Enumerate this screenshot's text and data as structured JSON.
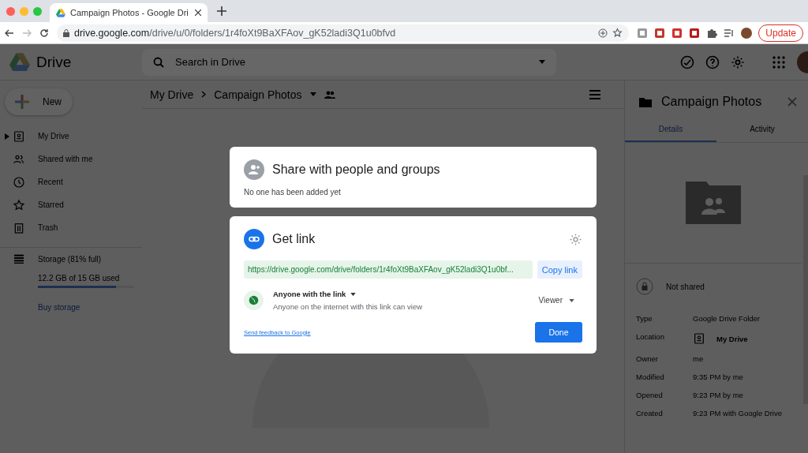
{
  "browser": {
    "tab_title": "Campaign Photos - Google Dri",
    "url_host": "drive.google.com",
    "url_path": "/drive/u/0/folders/1r4foXt9BaXFAov_gK52ladi3Q1u0bfvd",
    "update_button": "Update"
  },
  "header": {
    "logo_text": "Drive",
    "search_placeholder": "Search in Drive"
  },
  "sidebar": {
    "new_button": "New",
    "items": [
      {
        "label": "My Drive",
        "kind": "drive"
      },
      {
        "label": "Shared with me",
        "kind": "shared"
      },
      {
        "label": "Recent",
        "kind": "recent"
      },
      {
        "label": "Starred",
        "kind": "starred"
      },
      {
        "label": "Trash",
        "kind": "trash"
      }
    ],
    "storage": {
      "label": "Storage (81% full)",
      "usage": "12.2 GB of 15 GB used",
      "level": 0.81,
      "buy_link": "Buy storage"
    }
  },
  "breadcrumb": [
    "My Drive",
    "Campaign Photos"
  ],
  "share_dialog": {
    "title": "Share with people and groups",
    "subtitle": "No one has been added yet"
  },
  "link_dialog": {
    "title": "Get link",
    "url": "https://drive.google.com/drive/folders/1r4foXt9BaXFAov_gK52ladi3Q1u0bf...",
    "copy_button": "Copy link",
    "access_title": "Anyone with the link",
    "access_description": "Anyone on the internet with this link can view",
    "role": "Viewer",
    "feedback_link": "Send feedback to Google",
    "done_button": "Done"
  },
  "details_panel": {
    "title": "Campaign Photos",
    "tabs": [
      {
        "label": "Details",
        "selected": true
      },
      {
        "label": "Activity",
        "selected": false
      }
    ],
    "sharing": "Not shared",
    "properties": [
      {
        "label": "Type",
        "value": "Google Drive Folder",
        "kind": "text"
      },
      {
        "label": "Location",
        "value": "My Drive",
        "kind": "drive"
      },
      {
        "label": "Owner",
        "value": "me",
        "kind": "text"
      },
      {
        "label": "Modified",
        "value": "9:35 PM by me",
        "kind": "text"
      },
      {
        "label": "Opened",
        "value": "9:23 PM by me",
        "kind": "text"
      },
      {
        "label": "Created",
        "value": "9:23 PM with Google Drive",
        "kind": "text"
      }
    ]
  }
}
